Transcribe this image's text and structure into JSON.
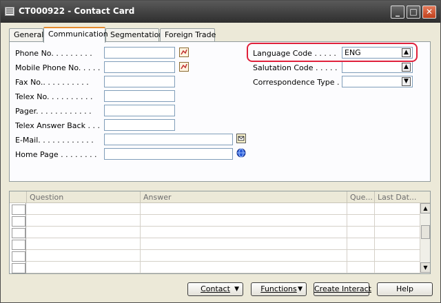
{
  "window": {
    "title": "CT000922 - Contact Card"
  },
  "titlebar": {
    "minimize": "_",
    "maximize": "□",
    "close": "✕"
  },
  "tabs": [
    {
      "label": "General"
    },
    {
      "label": "Communication"
    },
    {
      "label": "Segmentation"
    },
    {
      "label": "Foreign Trade"
    }
  ],
  "left_fields": [
    {
      "label": "Phone No. . . . . . . . .",
      "value": ""
    },
    {
      "label": "Mobile Phone No. . . . .",
      "value": ""
    },
    {
      "label": "Fax No.. . . . . . . . . .",
      "value": ""
    },
    {
      "label": "Telex No. . . . . . . . . .",
      "value": ""
    },
    {
      "label": "Pager. . . . . . . . . . . .",
      "value": ""
    },
    {
      "label": "Telex Answer Back . . .",
      "value": ""
    },
    {
      "label": "E-Mail. . . . . . . . . . . .",
      "value": ""
    },
    {
      "label": "Home Page . . . . . . . .",
      "value": ""
    }
  ],
  "right_fields": [
    {
      "label": "Language Code . . . . .",
      "value": "ENG"
    },
    {
      "label": "Salutation Code . . . . .",
      "value": ""
    },
    {
      "label": "Correspondence Type . .",
      "value": ""
    }
  ],
  "grid": {
    "columns": [
      "Question",
      "Answer",
      "Que...",
      "Last Dat..."
    ]
  },
  "buttons": {
    "contact": "Contact",
    "functions": "Functions",
    "create_interact": "Create Interact",
    "help": "Help"
  },
  "colors": {
    "highlight": "#e0203a",
    "tab_accent": "#e68b2c"
  }
}
